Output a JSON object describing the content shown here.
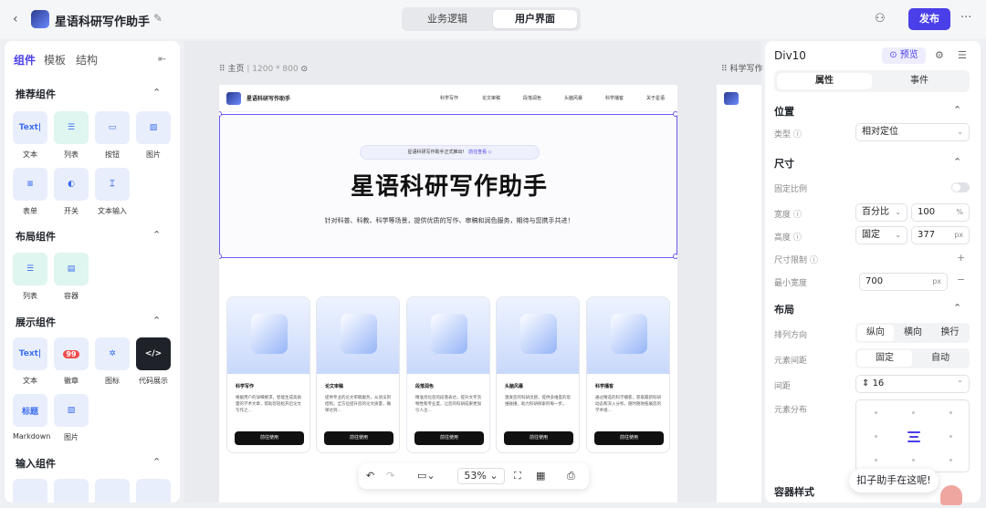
{
  "topbar": {
    "back": "‹",
    "title": "星语科研写作助手",
    "edit_icon": "✎",
    "tabs": [
      "业务逻辑",
      "用户界面"
    ],
    "active_tab": "用户界面",
    "share_icon": "⚇",
    "publish": "发布",
    "more": "···"
  },
  "left": {
    "tabs": [
      "组件",
      "模板",
      "结构"
    ],
    "collapse": "⇤",
    "sections": {
      "recommended": "推荐组件",
      "layout": "布局组件",
      "display": "展示组件",
      "input": "输入组件"
    },
    "recommended_items": [
      "文本",
      "列表",
      "按钮",
      "图片",
      "表单",
      "开关",
      "文本输入"
    ],
    "layout_items": [
      "列表",
      "容器"
    ],
    "display_items": [
      "文本",
      "徽章",
      "图标",
      "代码展示",
      "Markdown",
      "图片"
    ],
    "icon_text_label": "Text|",
    "badge_count": "99",
    "markdown_icon_text": "标题"
  },
  "canvas": {
    "page_label": "主页",
    "page_size": "1200 * 800",
    "page2_label": "科学写作",
    "zoom": "53%"
  },
  "page": {
    "name": "星语科研写作助手",
    "nav": [
      "科学写作",
      "论文审稿",
      "段落润色",
      "头脑风暴",
      "科学播客",
      "关于星语"
    ],
    "badge_text": "星语科研写作助手正式推出！",
    "badge_link": "前往查看 ◇",
    "title": "星语科研写作助手",
    "subtitle": "针对科普、科教、科学等场景，提供优质的写作、审稿和润色服务，期待与您携手共进！",
    "cards": [
      {
        "title": "科学写作",
        "desc": "根据用户的详细要求，智能生成高质量的学术文章，帮助您轻松开启论文写作之…",
        "button": "前往使用"
      },
      {
        "title": "论文审稿",
        "desc": "提供专业的论文审稿服务，从语法到结构，全方位提升您的论文质量，确保达到…",
        "button": "前往使用"
      },
      {
        "title": "段落润色",
        "desc": "精准优化您的段落表达，提升文字流畅性和专业度，让您的科研成果更加引人注…",
        "button": "前往使用"
      },
      {
        "title": "头脑风暴",
        "desc": "激发您的科研灵感，提供多维度的思维碰撞，助力科研探索的每一步。",
        "button": "前往使用"
      },
      {
        "title": "科学播客",
        "desc": "通过精选的科学播客，获取最新科研动态和深入分析，随时随地拓展您的学术视…",
        "button": "前往使用"
      }
    ]
  },
  "right": {
    "title": "Div10",
    "preview": "⊙ 预览",
    "tabs": [
      "属性",
      "事件"
    ],
    "position": {
      "section": "位置",
      "type_label": "类型 ⓘ",
      "type_value": "相对定位"
    },
    "size": {
      "section": "尺寸",
      "ratio_label": "固定比例",
      "width_label": "宽度 ⓘ",
      "width_mode": "百分比",
      "width_value": "100",
      "width_unit": "%",
      "height_label": "高度 ⓘ",
      "height_mode": "固定",
      "height_value": "377",
      "height_unit": "px",
      "limit_label": "尺寸限制 ⓘ",
      "min_width_label": "最小宽度",
      "min_width_value": "700",
      "min_width_unit": "px"
    },
    "layout": {
      "section": "布局",
      "direction_label": "排列方向",
      "directions": [
        "纵向",
        "横向",
        "换行"
      ],
      "gap_label": "元素间距",
      "gap_modes": [
        "固定",
        "自动"
      ],
      "spacing_label": "间距",
      "spacing_value": "16",
      "distribution_label": "元素分布"
    },
    "container_style": "容器样式"
  },
  "assistant": {
    "bubble": "扣子助手在这呢!"
  }
}
